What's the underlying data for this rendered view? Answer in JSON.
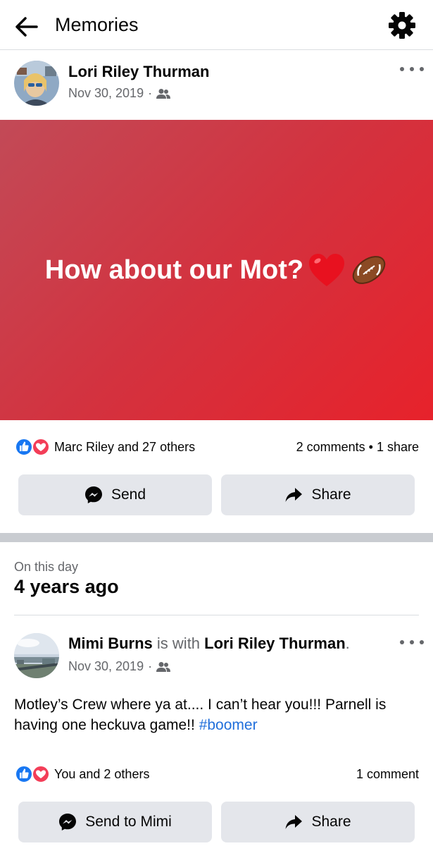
{
  "header": {
    "title": "Memories",
    "back_icon": "arrow-left-icon",
    "settings_icon": "gear-icon"
  },
  "post1": {
    "author": "Lori Riley Thurman",
    "date": "Nov 30, 2019",
    "date_separator": "·",
    "audience_icon": "friends-icon",
    "content": "How about our Mot?",
    "content_emojis": [
      "red-heart-icon",
      "football-icon"
    ],
    "background_colors": [
      "#c24a57",
      "#e7222b"
    ],
    "reactions": {
      "types": [
        "like",
        "love"
      ],
      "text": "Marc Riley and 27 others"
    },
    "counts": "2 comments • 1 share",
    "actions": {
      "send_label": "Send",
      "share_label": "Share"
    }
  },
  "on_this_day": {
    "subtitle": "On this day",
    "title": "4 years ago"
  },
  "post2": {
    "author": "Mimi Burns",
    "with_text": "is with",
    "tagged": "Lori Riley Thurman",
    "period": ".",
    "date": "Nov 30, 2019",
    "date_separator": "·",
    "audience_icon": "friends-icon",
    "text": "Motley’s Crew where ya at.... I can’t hear you!!! Parnell is having one heckuva game!!",
    "hashtag": "#boomer",
    "reactions": {
      "types": [
        "like",
        "love"
      ],
      "text": "You and 2 others"
    },
    "counts": "1 comment",
    "actions": {
      "send_label": "Send to Mimi",
      "share_label": "Share"
    }
  },
  "colors": {
    "accent_blue": "#1877f2",
    "love_red": "#f33e58",
    "hashtag_blue": "#216fdb",
    "secondary_text": "#65676b",
    "button_bg": "#e4e6eb"
  }
}
